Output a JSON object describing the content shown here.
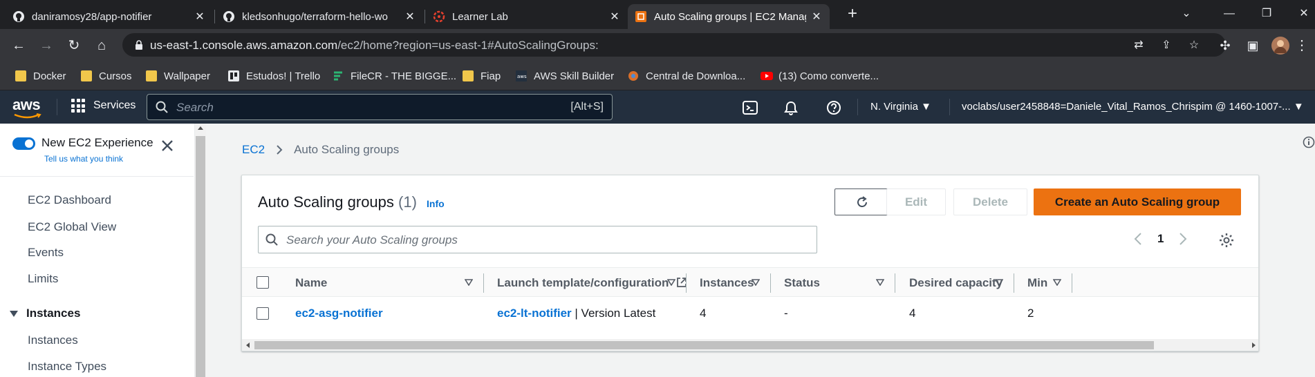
{
  "browser": {
    "tabs": [
      {
        "title": "daniramosy28/app-notifier",
        "icon": "github-icon"
      },
      {
        "title": "kledsonhugo/terraform-hello-wo",
        "icon": "github-icon"
      },
      {
        "title": "Learner Lab",
        "icon": "learner-lab-icon"
      },
      {
        "title": "Auto Scaling groups | EC2 Manag",
        "icon": "aws-ec2-icon"
      }
    ],
    "url_host": "us-east-1.console.aws.amazon.com",
    "url_path": "/ec2/home?region=us-east-1#AutoScalingGroups:",
    "bookmarks": [
      {
        "label": "Docker",
        "icon": "folder-icon"
      },
      {
        "label": "Cursos",
        "icon": "folder-icon"
      },
      {
        "label": "Wallpaper",
        "icon": "folder-icon"
      },
      {
        "label": "Estudos! | Trello",
        "icon": "trello-icon"
      },
      {
        "label": "FileCR - THE BIGGE...",
        "icon": "filecr-icon"
      },
      {
        "label": "Fiap",
        "icon": "folder-icon"
      },
      {
        "label": "AWS Skill Builder",
        "icon": "aws-icon"
      },
      {
        "label": "Central de Downloa...",
        "icon": "central-icon"
      },
      {
        "label": "(13) Como converte...",
        "icon": "youtube-icon"
      }
    ]
  },
  "aws_header": {
    "logo": "aws",
    "services_label": "Services",
    "search_placeholder": "Search",
    "search_shortcut": "[Alt+S]",
    "region": "N. Virginia",
    "account": "voclabs/user2458848=Daniele_Vital_Ramos_Chrispim @ 1460-1007-..."
  },
  "sidebar": {
    "toggle_label": "New EC2 Experience",
    "feedback_link": "Tell us what you think",
    "items": [
      "EC2 Dashboard",
      "EC2 Global View",
      "Events",
      "Limits"
    ],
    "section": "Instances",
    "section_items": [
      "Instances",
      "Instance Types"
    ]
  },
  "breadcrumb": {
    "root": "EC2",
    "current": "Auto Scaling groups"
  },
  "panel": {
    "title": "Auto Scaling groups",
    "count": "(1)",
    "info_link": "Info",
    "edit_label": "Edit",
    "delete_label": "Delete",
    "create_label": "Create an Auto Scaling group",
    "filter_placeholder": "Search your Auto Scaling groups",
    "page": "1",
    "columns": [
      "Name",
      "Launch template/configuration",
      "Instances",
      "Status",
      "Desired capacity",
      "Min"
    ],
    "rows": [
      {
        "name": "ec2-asg-notifier",
        "launch_template": "ec2-lt-notifier",
        "version": " | Version Latest",
        "instances": "4",
        "status": "-",
        "desired": "4",
        "min": "2"
      }
    ]
  },
  "colors": {
    "aws_header_bg": "#232f3e",
    "link": "#0972d3",
    "primary_button": "#ec7211"
  }
}
